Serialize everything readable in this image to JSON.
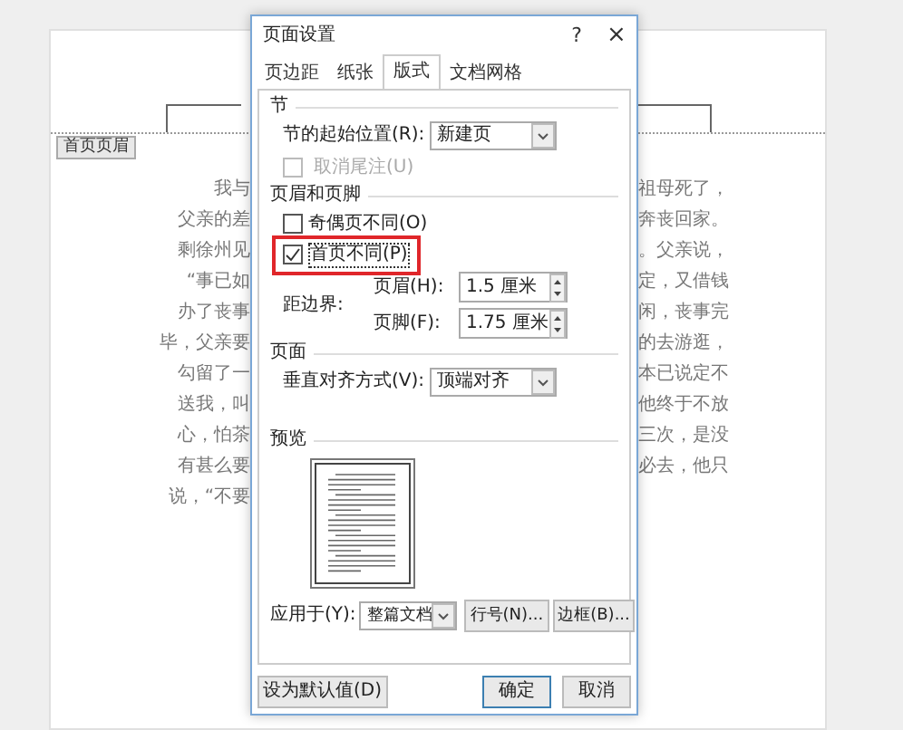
{
  "document": {
    "header_tag": "首页页眉",
    "lines": [
      {
        "left": "我与",
        "right": "祖母死了，"
      },
      {
        "left": "父亲的差",
        "right": "奔丧回家。"
      },
      {
        "left": "剩徐州见",
        "right": "。父亲说，"
      },
      {
        "left": "“事已如",
        "right": "定，又借钱"
      },
      {
        "left": "办了丧事",
        "right": "闲，丧事完"
      },
      {
        "left": "毕，父亲要",
        "right": "的去游逛，"
      },
      {
        "left": "勾留了一",
        "right": "本已说定不"
      },
      {
        "left": "送我，叫",
        "right": "他终于不放"
      },
      {
        "left": "心，怕茶",
        "right": "三次，是没"
      },
      {
        "left": "有甚么要",
        "right": "必去，他只"
      },
      {
        "left": "说，“不要"
      }
    ]
  },
  "dialog": {
    "title": "页面设置",
    "help": "?",
    "close": "×",
    "tabs": [
      {
        "label": "页边距",
        "selected": false
      },
      {
        "label": "纸张",
        "selected": false
      },
      {
        "label": "版式",
        "selected": true
      },
      {
        "label": "文档网格",
        "selected": false
      }
    ],
    "section": {
      "title": "节",
      "start_label": "节的起始位置(R):",
      "start_value": "新建页",
      "endnote": {
        "label": "取消尾注(U)",
        "checked": false,
        "disabled": true
      }
    },
    "header_footer": {
      "title": "页眉和页脚",
      "options": [
        {
          "label": "奇偶页不同(O)",
          "checked": false,
          "highlighted": false
        },
        {
          "label": "首页不同(P)",
          "checked": true,
          "highlighted": true
        }
      ],
      "distance_label": "距边界:",
      "fields": [
        {
          "label": "页眉(H):",
          "value": "1.5 厘米"
        },
        {
          "label": "页脚(F):",
          "value": "1.75 厘米"
        }
      ]
    },
    "page": {
      "title": "页面",
      "align_label": "垂直对齐方式(V):",
      "align_value": "顶端对齐"
    },
    "preview": {
      "title": "预览",
      "apply_label": "应用于(Y):",
      "apply_value": "整篇文档",
      "buttons": [
        "行号(N)...",
        "边框(B)..."
      ]
    },
    "footer": {
      "default_button": "设为默认值(D)",
      "ok": "确定",
      "cancel": "取消"
    }
  }
}
